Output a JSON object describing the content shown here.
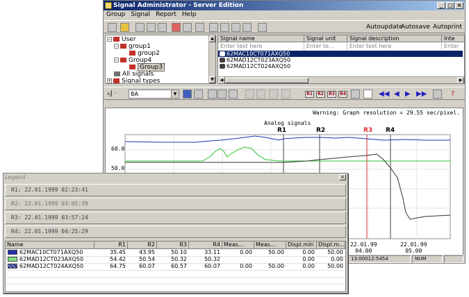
{
  "app": {
    "title": "Signal Administrator - Server Edition",
    "menu": [
      "Group",
      "Signal",
      "Report",
      "Help"
    ]
  },
  "toolbar": {
    "autoupdate": "Autoupdate",
    "autosave": "Autosave",
    "autoprint": "Autoprint"
  },
  "tree": {
    "items": [
      {
        "label": "User"
      },
      {
        "label": "group1"
      },
      {
        "label": "group2"
      },
      {
        "label": "Group4"
      },
      {
        "label": "Group3"
      },
      {
        "label": "All signals"
      },
      {
        "label": "Signal types"
      }
    ]
  },
  "signal_grid": {
    "columns": [
      "Signal name",
      "Signal unit",
      "Signal description",
      "Inte"
    ],
    "filters": [
      "Enter text here",
      "Enter te...",
      "Enter text here",
      "Enter"
    ],
    "rows": [
      "62MAC10CT071AXQ50",
      "62MAD12CT023AXQ50",
      "62MAD12CT024AXQ50"
    ]
  },
  "toolbar2": {
    "combo_value": "BA"
  },
  "chart_data": {
    "type": "line",
    "title": "Analog signals",
    "warning": "Warning: Graph resolution = 29.55 sec/pixel.",
    "y_ticks": [
      "60.0",
      "50.0"
    ],
    "x_ticks": [
      {
        "date": "22.01.99",
        "time": "04.00"
      },
      {
        "date": "22.01.99",
        "time": "05.00"
      }
    ],
    "cursors": [
      "R1",
      "R2",
      "R3",
      "R4"
    ],
    "series": [
      {
        "name": "62MAC10CT071AXQ50",
        "color": "#2030b0"
      },
      {
        "name": "62MAD12CT023AXQ50",
        "color": "#30c030"
      },
      {
        "name": "62MAD12CT024AXQ50",
        "color": "#303030"
      }
    ]
  },
  "statusbar": {
    "time": "13:00012:5454",
    "num": "NUM"
  },
  "legend": {
    "title": "Legend",
    "cursor_rows": [
      "R1: 22.01.1999 02:23:41",
      "R2: 22.01.1999 03:05:39",
      "R3: 22.01.1999 03:57:24",
      "R4: 22.01.1999 04:25:29"
    ],
    "columns": [
      "Name",
      "R1",
      "R2",
      "R3",
      "R4",
      "Meas...",
      "Meas...",
      "Displ.min",
      "Displ.m..."
    ],
    "rows": [
      {
        "name": "62MAC10CT071AXQ50",
        "color": "#2030b0",
        "r1": "35.45",
        "r2": "43.95",
        "r3": "50.10",
        "r4": "33.11",
        "m1": "0.00",
        "m2": "50.00",
        "dmin": "0.00",
        "dmax": "50.00"
      },
      {
        "name": "62MAD12CT023AXQ50",
        "color": "#80e080",
        "r1": "54.42",
        "r2": "50.54",
        "r3": "50.32",
        "r4": "50.32",
        "m1": "",
        "m2": "",
        "dmin": "0.00",
        "dmax": "0.00"
      },
      {
        "name": "62MAD12CT024AXQ50",
        "color": "#203080",
        "r1": "64.75",
        "r2": "60.07",
        "r3": "60.57",
        "r4": "60.07",
        "m1": "0.00",
        "m2": "50.00",
        "dmin": "0.00",
        "dmax": "50.00"
      }
    ]
  }
}
